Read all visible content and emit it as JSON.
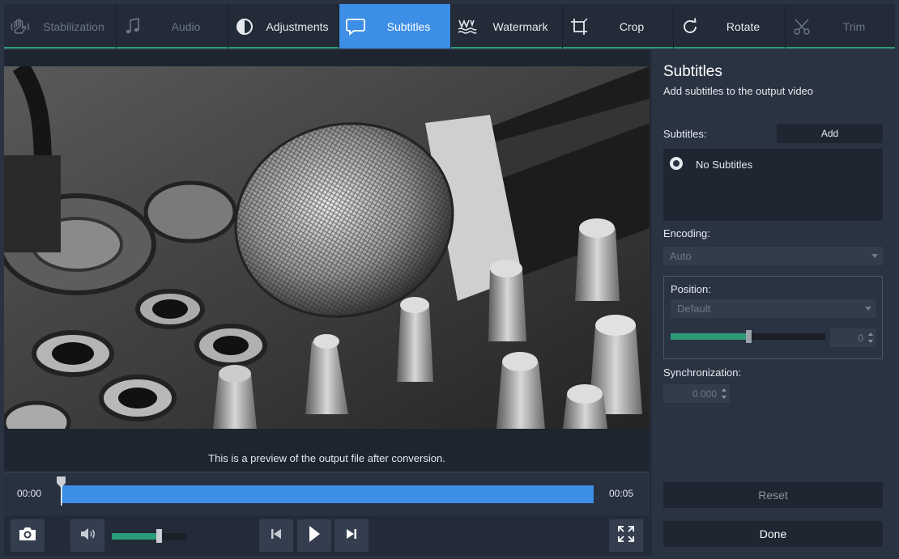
{
  "tabs": [
    {
      "label": "Stabilization",
      "icon": "hand-icon",
      "state": "disabled"
    },
    {
      "label": "Audio",
      "icon": "music-note-icon",
      "state": "disabled"
    },
    {
      "label": "Adjustments",
      "icon": "contrast-icon",
      "state": "normal"
    },
    {
      "label": "Subtitles",
      "icon": "speech-bubble-icon",
      "state": "active"
    },
    {
      "label": "Watermark",
      "icon": "watermark-icon",
      "state": "normal"
    },
    {
      "label": "Crop",
      "icon": "crop-icon",
      "state": "normal"
    },
    {
      "label": "Rotate",
      "icon": "rotate-icon",
      "state": "normal"
    },
    {
      "label": "Trim",
      "icon": "scissors-icon",
      "state": "disabled"
    }
  ],
  "preview": {
    "caption": "This is a preview of the output file after conversion."
  },
  "timeline": {
    "start": "00:00",
    "end": "00:05",
    "position": 0
  },
  "controls": {
    "volume": 0.62
  },
  "panel": {
    "title": "Subtitles",
    "subtitle": "Add subtitles to the output video",
    "subtitles_label": "Subtitles:",
    "add_label": "Add",
    "subtitle_options": [
      "No Subtitles"
    ],
    "encoding_label": "Encoding:",
    "encoding_value": "Auto",
    "position_label": "Position:",
    "position_value": "Default",
    "position_offset": "0",
    "position_slider": 0.5,
    "sync_label": "Synchronization:",
    "sync_value": "0.000",
    "reset_label": "Reset",
    "done_label": "Done"
  },
  "colors": {
    "accent": "#3d8ee6",
    "green": "#2c9c78",
    "panel_bg": "#2a3342"
  }
}
